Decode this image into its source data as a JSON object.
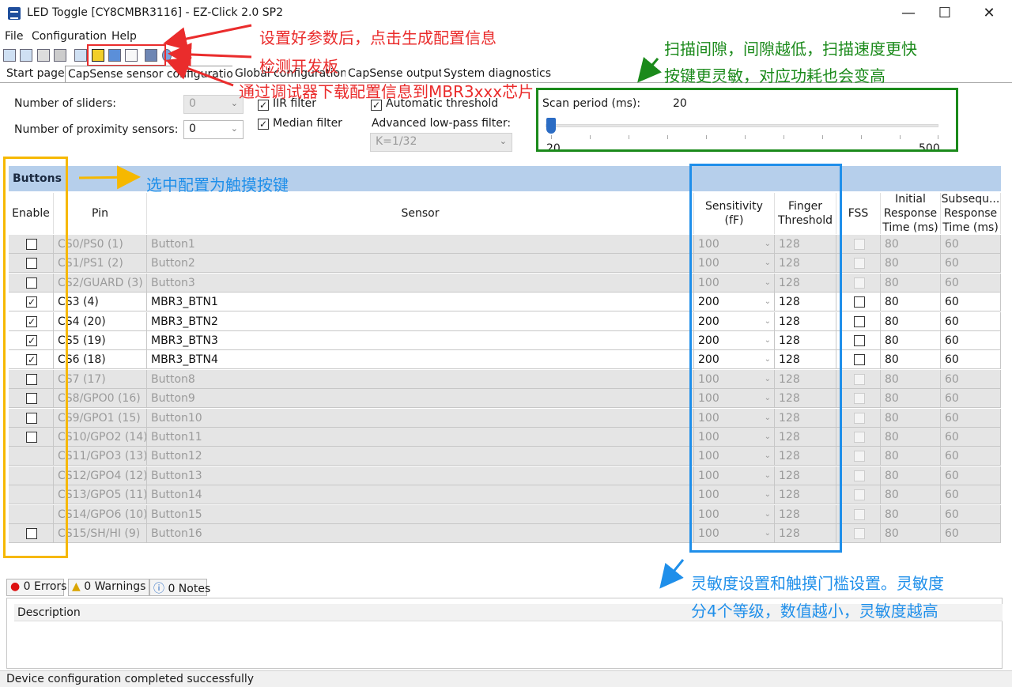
{
  "window": {
    "title": "LED Toggle [CY8CMBR3116] - EZ-Click 2.0 SP2",
    "minimize": "—",
    "maximize": "☐",
    "close": "✕"
  },
  "menu": [
    "File",
    "Configuration",
    "Help"
  ],
  "tabs": [
    "Start page",
    "CapSense sensor configuration",
    "Global configuration",
    "CapSense output",
    "System diagnostics"
  ],
  "settings": {
    "sliders_label": "Number of sliders:",
    "sliders_value": "0",
    "proximity_label": "Number of proximity sensors:",
    "proximity_value": "0",
    "iir_label": "IIR filter",
    "median_label": "Median filter",
    "auto_threshold_label": "Automatic threshold",
    "lowpass_label": "Advanced low-pass filter:",
    "lowpass_value": "K=1/32",
    "scan_label": "Scan period (ms):",
    "scan_value": "20",
    "scan_min": "20",
    "scan_max": "500"
  },
  "grid": {
    "section_title": "Buttons",
    "columns": [
      "Enable",
      "Pin",
      "Sensor",
      "Sensitivity (fF)",
      "Finger Threshold",
      "FSS",
      "Initial Response Time (ms)",
      "Subsequ... Response Time (ms)"
    ],
    "rows": [
      {
        "enable": false,
        "pin": "CS0/PS0 (1)",
        "sensor": "Button1",
        "sens": "100",
        "thr": "128",
        "fss": false,
        "init": "80",
        "sub": "60",
        "active": false,
        "chk_visible": true
      },
      {
        "enable": false,
        "pin": "CS1/PS1 (2)",
        "sensor": "Button2",
        "sens": "100",
        "thr": "128",
        "fss": false,
        "init": "80",
        "sub": "60",
        "active": false,
        "chk_visible": true
      },
      {
        "enable": false,
        "pin": "CS2/GUARD (3)",
        "sensor": "Button3",
        "sens": "100",
        "thr": "128",
        "fss": false,
        "init": "80",
        "sub": "60",
        "active": false,
        "chk_visible": true
      },
      {
        "enable": true,
        "pin": "CS3 (4)",
        "sensor": "MBR3_BTN1",
        "sens": "200",
        "thr": "128",
        "fss": false,
        "init": "80",
        "sub": "60",
        "active": true,
        "chk_visible": true
      },
      {
        "enable": true,
        "pin": "CS4 (20)",
        "sensor": "MBR3_BTN2",
        "sens": "200",
        "thr": "128",
        "fss": false,
        "init": "80",
        "sub": "60",
        "active": true,
        "chk_visible": true
      },
      {
        "enable": true,
        "pin": "CS5 (19)",
        "sensor": "MBR3_BTN3",
        "sens": "200",
        "thr": "128",
        "fss": false,
        "init": "80",
        "sub": "60",
        "active": true,
        "chk_visible": true
      },
      {
        "enable": true,
        "pin": "CS6 (18)",
        "sensor": "MBR3_BTN4",
        "sens": "200",
        "thr": "128",
        "fss": false,
        "init": "80",
        "sub": "60",
        "active": true,
        "chk_visible": true
      },
      {
        "enable": false,
        "pin": "CS7 (17)",
        "sensor": "Button8",
        "sens": "100",
        "thr": "128",
        "fss": false,
        "init": "80",
        "sub": "60",
        "active": false,
        "chk_visible": true
      },
      {
        "enable": false,
        "pin": "CS8/GPO0 (16)",
        "sensor": "Button9",
        "sens": "100",
        "thr": "128",
        "fss": false,
        "init": "80",
        "sub": "60",
        "active": false,
        "chk_visible": true
      },
      {
        "enable": false,
        "pin": "CS9/GPO1 (15)",
        "sensor": "Button10",
        "sens": "100",
        "thr": "128",
        "fss": false,
        "init": "80",
        "sub": "60",
        "active": false,
        "chk_visible": true
      },
      {
        "enable": false,
        "pin": "CS10/GPO2 (14)",
        "sensor": "Button11",
        "sens": "100",
        "thr": "128",
        "fss": false,
        "init": "80",
        "sub": "60",
        "active": false,
        "chk_visible": true
      },
      {
        "enable": false,
        "pin": "CS11/GPO3 (13)",
        "sensor": "Button12",
        "sens": "100",
        "thr": "128",
        "fss": false,
        "init": "80",
        "sub": "60",
        "active": false,
        "chk_visible": false
      },
      {
        "enable": false,
        "pin": "CS12/GPO4 (12)",
        "sensor": "Button13",
        "sens": "100",
        "thr": "128",
        "fss": false,
        "init": "80",
        "sub": "60",
        "active": false,
        "chk_visible": false
      },
      {
        "enable": false,
        "pin": "CS13/GPO5 (11)",
        "sensor": "Button14",
        "sens": "100",
        "thr": "128",
        "fss": false,
        "init": "80",
        "sub": "60",
        "active": false,
        "chk_visible": false
      },
      {
        "enable": false,
        "pin": "CS14/GPO6 (10)",
        "sensor": "Button15",
        "sens": "100",
        "thr": "128",
        "fss": false,
        "init": "80",
        "sub": "60",
        "active": false,
        "chk_visible": false
      },
      {
        "enable": false,
        "pin": "CS15/SH/HI (9)",
        "sensor": "Button16",
        "sens": "100",
        "thr": "128",
        "fss": false,
        "init": "80",
        "sub": "60",
        "active": false,
        "chk_visible": true
      }
    ]
  },
  "messages": {
    "errors": "0 Errors",
    "warnings": "0 Warnings",
    "notes": "0 Notes",
    "description_header": "Description"
  },
  "status": "Device configuration completed successfully",
  "annotations": {
    "generate_config": "设置好参数后，点击生成配置信息",
    "detect_board": "检测开发板",
    "download_config": "通过调试器下载配置信息到MBR3xxx芯片",
    "scan_gap_1": "扫描间隙，间隙越低，扫描速度更快",
    "scan_gap_2": "按键更灵敏，对应功耗也会变高",
    "select_buttons": "选中配置为触摸按键",
    "sensitivity_1": "灵敏度设置和触摸门槛设置。灵敏度",
    "sensitivity_2": "分4个等级，数值越小，灵敏度越高"
  },
  "colors": {
    "annot_red": "#ea2c2c",
    "annot_green": "#1b8a1b",
    "annot_blue": "#1f8fea",
    "annot_orange": "#f6b800",
    "grid_header": "#b6cfeb"
  }
}
